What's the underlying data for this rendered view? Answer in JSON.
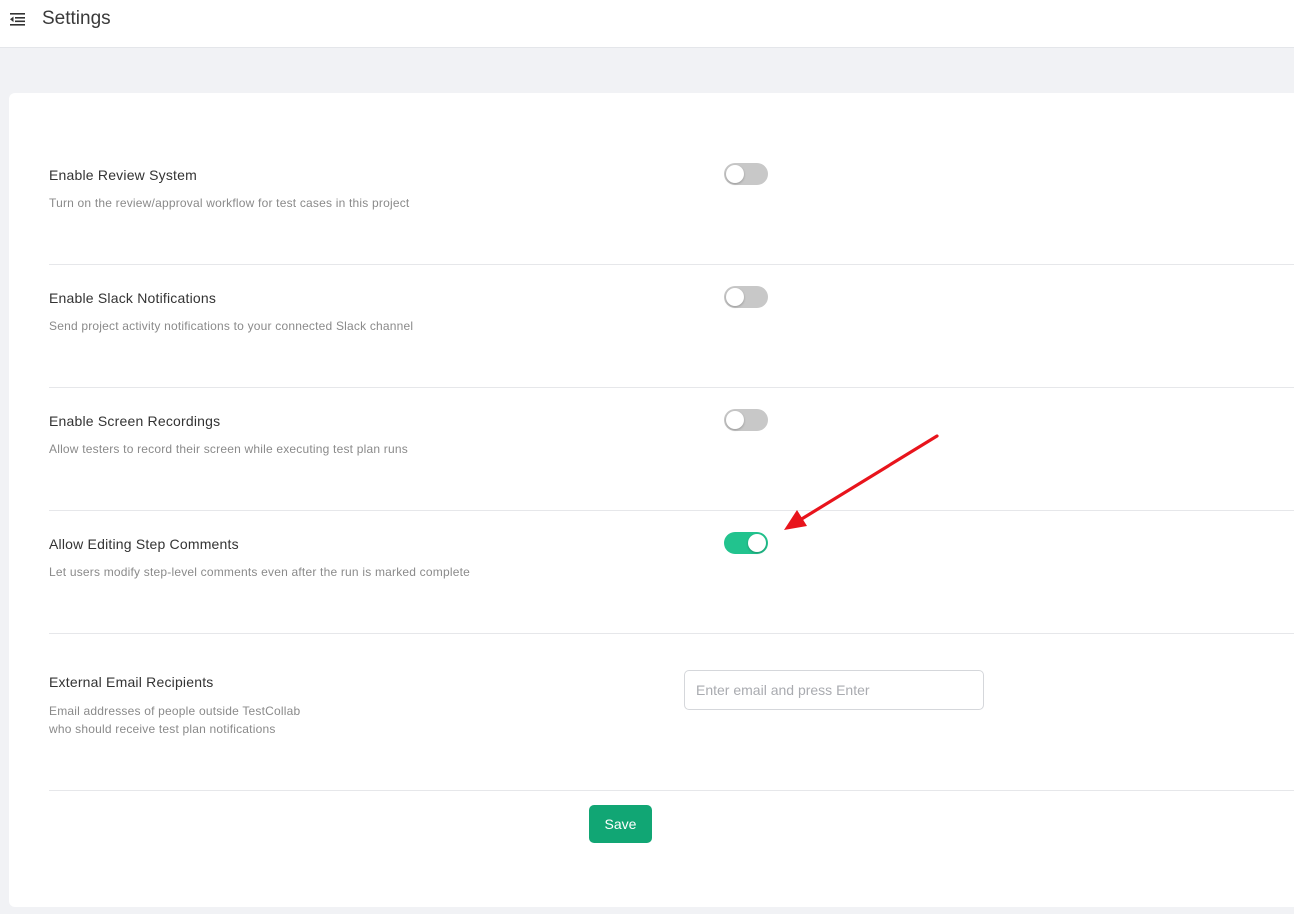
{
  "header": {
    "title": "Settings",
    "menu_icon": "menu-collapse-icon"
  },
  "settings": [
    {
      "label": "Enable Review System",
      "description": "Turn on the review/approval workflow for test cases in this project",
      "enabled": false
    },
    {
      "label": "Enable Slack Notifications",
      "description": "Send project activity notifications to your connected Slack channel",
      "enabled": false
    },
    {
      "label": "Enable Screen Recordings",
      "description": "Allow testers to record their screen while executing test plan runs",
      "enabled": false
    },
    {
      "label": "Allow Editing Step Comments",
      "description": "Let users modify step-level comments even after the run is marked complete",
      "enabled": true
    }
  ],
  "external_email": {
    "label": "External Email Recipients",
    "description_line1": "Email addresses of people outside TestCollab",
    "description_line2": "who should receive test plan notifications",
    "value": "",
    "placeholder": "Enter email and press Enter"
  },
  "save_label": "Save",
  "colors": {
    "toggle_on": "#22c38e",
    "toggle_off": "#c8c8c8",
    "save_button": "#11a674",
    "annotation_arrow": "#e8141c"
  }
}
